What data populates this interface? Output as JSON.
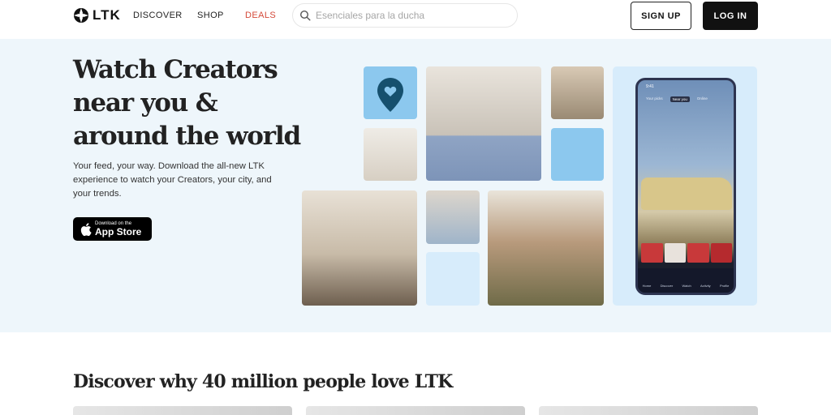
{
  "header": {
    "logo_text": "LTK",
    "nav": {
      "discover": "DISCOVER",
      "shop": "SHOP",
      "deals": "DEALS"
    },
    "search": {
      "placeholder": "Esenciales para la ducha",
      "value": ""
    },
    "signup_label": "SIGN UP",
    "login_label": "LOG IN"
  },
  "hero": {
    "title": "Watch Creators near you & around the world",
    "subtitle": "Your feed, your way. Download the all-new LTK experience to watch your Creators, your city, and your trends.",
    "appstore": {
      "small": "Download on the",
      "big": "App Store"
    }
  },
  "phone": {
    "time": "9:41",
    "tabs": [
      "Your picks",
      "Near you",
      "Online"
    ],
    "nav": [
      "Home",
      "Discover",
      "Watch",
      "Activity",
      "Profile"
    ]
  },
  "section": {
    "title": "Discover why 40 million people love LTK"
  },
  "colors": {
    "deals": "#d44a3a",
    "hero_bg": "#eef6fb",
    "tile_blue": "#8cc8ee",
    "tile_pale": "#d7ecfb",
    "button_dark": "#111111"
  },
  "icons": [
    "ltk-logo-icon",
    "search-icon",
    "location-pin-icon",
    "apple-icon"
  ]
}
